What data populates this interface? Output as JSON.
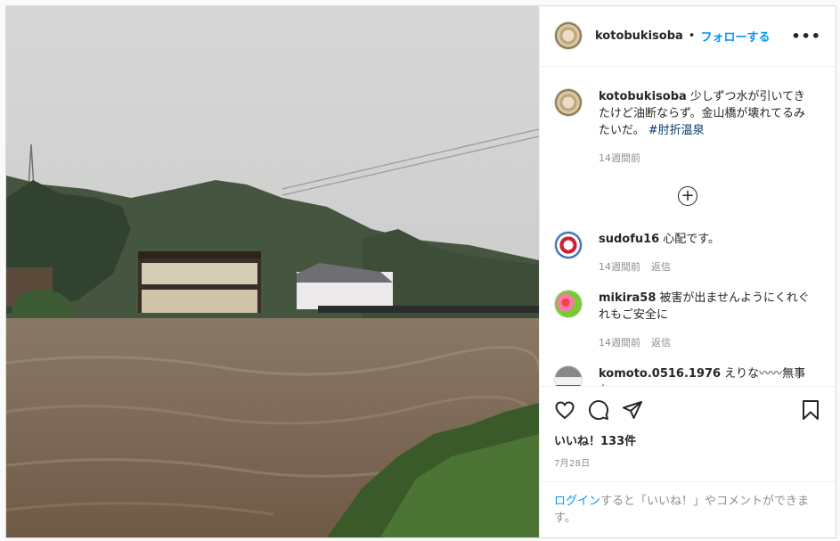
{
  "post": {
    "username": "kotobukisoba",
    "separator": "•",
    "follow_label": "フォローする",
    "more_label": "•••"
  },
  "caption": {
    "username": "kotobukisoba",
    "text": "少しずつ水が引いてきたけど油断ならず。金山橋が壊れてるみたいだ。",
    "hashtag": "#肘折温泉",
    "time": "14週間前"
  },
  "comments": [
    {
      "username": "sudofu16",
      "text": "心配です。",
      "time": "14週間前",
      "reply": "返信"
    },
    {
      "username": "mikira58",
      "text": "被害が出ませんようにくれぐれもご安全に",
      "time": "14週間前",
      "reply": "返信"
    },
    {
      "username": "komoto.0516.1976",
      "text": "えりな〰〰無事かぁ",
      "time": "",
      "reply": ""
    }
  ],
  "likes": {
    "label": "いいね！",
    "count": "133件"
  },
  "date": "7月28日",
  "login": {
    "link": "ログイン",
    "rest": "すると「いいね！」やコメントができます。"
  },
  "icons": [
    "heart-icon",
    "comment-icon",
    "share-icon",
    "bookmark-icon",
    "plus-circle-icon"
  ]
}
